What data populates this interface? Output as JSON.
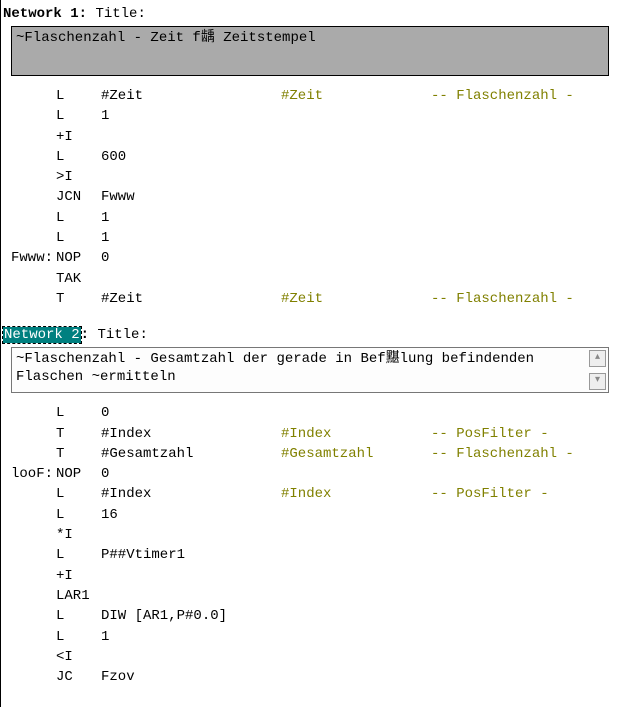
{
  "network1": {
    "label": "Network 1",
    "title_word": "Title:",
    "title_text": "~Flaschenzahl - Zeit f龋 Zeitstempel",
    "rows": [
      {
        "label": "",
        "ins": "L",
        "opd": "#Zeit",
        "sym": "#Zeit",
        "cmt": "-- Flaschenzahl -"
      },
      {
        "label": "",
        "ins": "L",
        "opd": "1",
        "sym": "",
        "cmt": ""
      },
      {
        "label": "",
        "ins": "+I",
        "opd": "",
        "sym": "",
        "cmt": ""
      },
      {
        "label": "",
        "ins": "L",
        "opd": "600",
        "sym": "",
        "cmt": ""
      },
      {
        "label": "",
        "ins": ">I",
        "opd": "",
        "sym": "",
        "cmt": ""
      },
      {
        "label": "",
        "ins": "JCN",
        "opd": "Fwww",
        "sym": "",
        "cmt": ""
      },
      {
        "label": "",
        "ins": "L",
        "opd": "1",
        "sym": "",
        "cmt": ""
      },
      {
        "label": "",
        "ins": "L",
        "opd": "1",
        "sym": "",
        "cmt": ""
      },
      {
        "label": "Fwww:",
        "ins": "NOP",
        "opd": "0",
        "sym": "",
        "cmt": ""
      },
      {
        "label": "",
        "ins": "TAK",
        "opd": "",
        "sym": "",
        "cmt": ""
      },
      {
        "label": "",
        "ins": "T",
        "opd": "#Zeit",
        "sym": "#Zeit",
        "cmt": "-- Flaschenzahl -"
      }
    ]
  },
  "network2": {
    "label": "Network 2",
    "title_word": "Title:",
    "title_text": "~Flaschenzahl - Gesamtzahl der gerade in Bef黮lung befindenden Flaschen ~ermitteln",
    "rows": [
      {
        "label": "",
        "ins": "L",
        "opd": "0",
        "sym": "",
        "cmt": ""
      },
      {
        "label": "",
        "ins": "T",
        "opd": "#Index",
        "sym": "#Index",
        "cmt": "-- PosFilter -"
      },
      {
        "label": "",
        "ins": "T",
        "opd": "#Gesamtzahl",
        "sym": "#Gesamtzahl",
        "cmt": "-- Flaschenzahl -"
      },
      {
        "label": "looF:",
        "ins": "NOP",
        "opd": "0",
        "sym": "",
        "cmt": ""
      },
      {
        "label": "",
        "ins": "L",
        "opd": "#Index",
        "sym": "#Index",
        "cmt": "-- PosFilter -"
      },
      {
        "label": "",
        "ins": "L",
        "opd": "16",
        "sym": "",
        "cmt": ""
      },
      {
        "label": "",
        "ins": "*I",
        "opd": "",
        "sym": "",
        "cmt": ""
      },
      {
        "label": "",
        "ins": "L",
        "opd": "P##Vtimer1",
        "sym": "",
        "cmt": ""
      },
      {
        "label": "",
        "ins": "+I",
        "opd": "",
        "sym": "",
        "cmt": ""
      },
      {
        "label": "",
        "ins": "LAR1",
        "opd": "",
        "sym": "",
        "cmt": ""
      },
      {
        "label": "",
        "ins": "L",
        "opd": "DIW [AR1,P#0.0]",
        "sym": "",
        "cmt": ""
      },
      {
        "label": "",
        "ins": "L",
        "opd": "1",
        "sym": "",
        "cmt": ""
      },
      {
        "label": "",
        "ins": "<I",
        "opd": "",
        "sym": "",
        "cmt": ""
      },
      {
        "label": "",
        "ins": "JC",
        "opd": "Fzov",
        "sym": "",
        "cmt": ""
      }
    ]
  }
}
